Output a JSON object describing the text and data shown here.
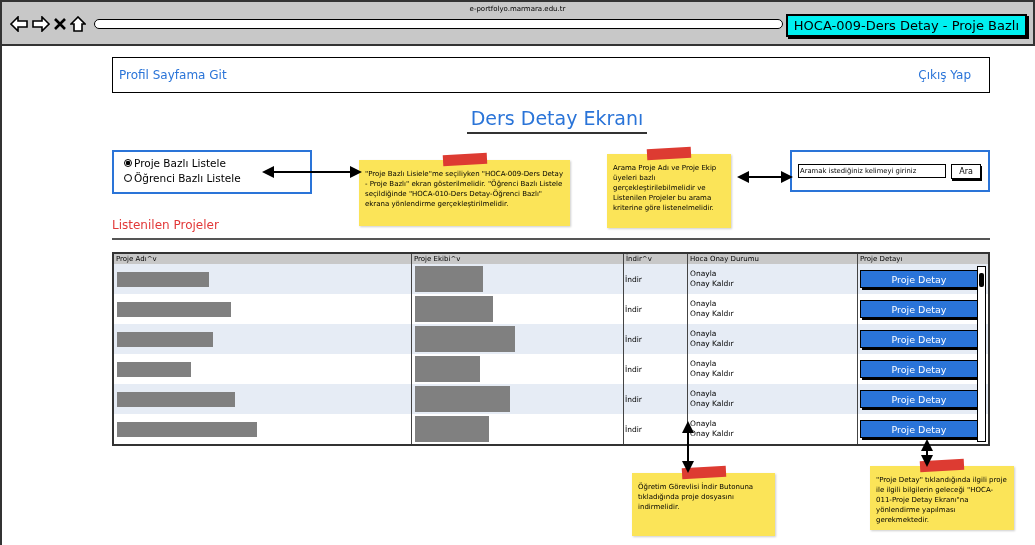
{
  "browser": {
    "url": "e-portfolyo.marmara.edu.tr",
    "screen_label": "HOCA-009-Ders Detay - Proje Bazlı"
  },
  "nav": {
    "profile_link": "Profil Sayfama Git",
    "logout_link": "Çıkış Yap"
  },
  "title": "Ders Detay Ekranı",
  "list_mode": [
    {
      "label": "Proje Bazlı Listele",
      "selected": true
    },
    {
      "label": "Öğrenci Bazlı Listele",
      "selected": false
    }
  ],
  "search": {
    "placeholder": "Aramak istediğiniz kelimeyi giriniz",
    "button": "Ara"
  },
  "section_title": "Listenilen Projeler",
  "table": {
    "columns": [
      "Proje Adı^v",
      "Proje Ekibi^v",
      "İndir^v",
      "Hoca Onay Durumu",
      "Proje Detayı"
    ],
    "rows": [
      {
        "download": "İndir",
        "approve": "Onayla",
        "unapprove": "Onay Kaldır",
        "detail_button": "Proje Detay"
      },
      {
        "download": "İndir",
        "approve": "Onayla",
        "unapprove": "Onay Kaldır",
        "detail_button": "Proje Detay"
      },
      {
        "download": "İndir",
        "approve": "Onayla",
        "unapprove": "Onay Kaldır",
        "detail_button": "Proje Detay"
      },
      {
        "download": "İndir",
        "approve": "Onayla",
        "unapprove": "Onay Kaldır",
        "detail_button": "Proje Detay"
      },
      {
        "download": "İndir",
        "approve": "Onayla",
        "unapprove": "Onay Kaldır",
        "detail_button": "Proje Detay"
      },
      {
        "download": "İndir",
        "approve": "Onayla",
        "unapprove": "Onay Kaldır",
        "detail_button": "Proje Detay"
      }
    ]
  },
  "notes": [
    {
      "text": "\"Proje Bazlı Lisiele\"me seçiliyken \"HOCA-009-Ders Detay - Proje Bazlı\" ekran gösterilmelidir. \"Öğrenci Bazlı Listele seçildiğinde \"HOCA-010-Ders Detay-Öğrenci Bazlı\" ekrana yönlendirme gerçekleştirilmelidir."
    },
    {
      "text": "Arama Proje Adı ve Proje Ekip üyeleri bazlı gerçekleştirilebilmelidir ve Listenilen Projeler bu arama kriterine göre listenelmelidir."
    },
    {
      "text": "Öğretim Görevlisi İndir Butonuna tıkladığında proje dosyasını indirmelidir."
    },
    {
      "text": "\"Proje Detay\" tıklandığında ilgili proje ile ilgili bilgilerin geleceği \"HOCA-011-Proje Detay Ekranı\"na yönlendirme yapılması gerekmektedir."
    }
  ]
}
